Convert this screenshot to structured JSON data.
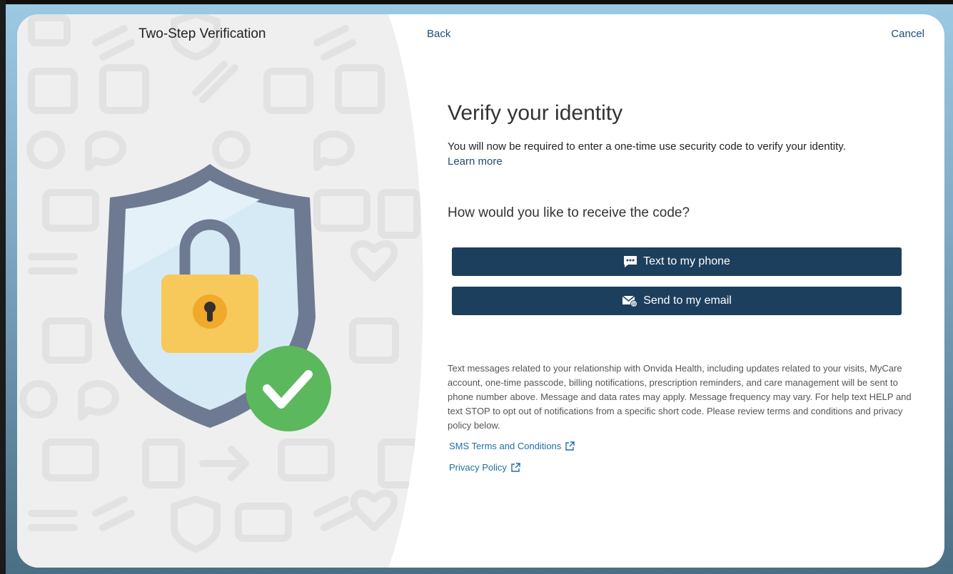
{
  "panel": {
    "title": "Two-Step Verification"
  },
  "nav": {
    "back_label": "Back",
    "cancel_label": "Cancel"
  },
  "main": {
    "heading": "Verify your identity",
    "description": "You will now be required to enter a one-time use security code to verify your identity.",
    "learn_more": "Learn more",
    "question": "How would you like to receive the code?"
  },
  "options": [
    {
      "label": "Text to my phone",
      "icon": "chat-bubble-icon"
    },
    {
      "label": "Send to my email",
      "icon": "email-icon"
    }
  ],
  "disclaimer": "Text messages related to your relationship with Onvida Health, including updates related to your visits, MyCare account, one-time passcode, billing notifications, prescription reminders, and care management will be sent to phone number above. Message and data rates may apply. Message frequency may vary. For help text HELP and text STOP to opt out of notifications from a specific short code. Please review terms and conditions and privacy policy below.",
  "links": {
    "sms_terms": "SMS Terms and Conditions",
    "privacy_policy": "Privacy Policy"
  },
  "colors": {
    "button_bg": "#1d3f5e",
    "link": "#1d4d75",
    "shield": "#6d7a91",
    "check": "#5cb85c",
    "lock": "#f7c95a"
  }
}
